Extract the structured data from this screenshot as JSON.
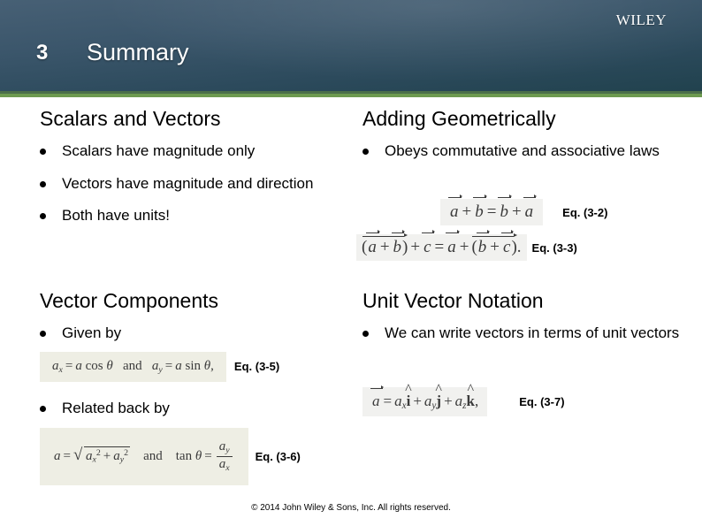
{
  "header": {
    "slide_number": "3",
    "title": "Summary",
    "logo_text": "Wiley",
    "bg_top_color": "#476075",
    "bg_bottom_color": "#21424e",
    "rule_dark_color": "#4b6f4a",
    "rule_green_color": "#6d9a50"
  },
  "sections": {
    "scalars": {
      "title": "Scalars and Vectors",
      "bullets": [
        "Scalars have magnitude only",
        "Vectors have magnitude and direction",
        "Both have units!"
      ]
    },
    "adding": {
      "title": "Adding Geometrically",
      "bullets": [
        "Obeys commutative and associative laws"
      ]
    },
    "components": {
      "title": "Vector Components",
      "bullets": [
        "Given by",
        "Related back by"
      ]
    },
    "unitvector": {
      "title": "Unit Vector Notation",
      "bullets": [
        "We can write vectors in terms of unit vectors"
      ]
    }
  },
  "equations": {
    "eq32": {
      "label": "Eq. (3-2)",
      "latex": "a⃗ + b⃗ = b⃗ + a⃗",
      "parts": {
        "a1": "a",
        "b1": "b",
        "b2": "b",
        "a2": "a",
        "plus": "+",
        "equals": "="
      }
    },
    "eq33": {
      "label": "Eq. (3-3)",
      "latex": "(a⃗ + b⃗) + c⃗ = a⃗ + (b⃗ + c⃗).",
      "parts": {
        "a1": "a",
        "b1": "b",
        "c1": "c",
        "a2": "a",
        "b2": "b",
        "c2": "c",
        "open": "(",
        "close": ")",
        "period": "."
      }
    },
    "eq35": {
      "label": "Eq. (3-5)",
      "latex": "a_x = a cos θ  and  a_y = a sin θ,",
      "parts": {
        "a": "a",
        "x": "x",
        "y": "y",
        "cos": "cos",
        "sin": "sin",
        "theta": "θ",
        "and": "and",
        "comma": ","
      }
    },
    "eq36": {
      "label": "Eq. (3-6)",
      "latex": "a = √(a_x² + a_y²)  and  tan θ = a_y / a_x",
      "parts": {
        "a": "a",
        "x": "x",
        "y": "y",
        "two": "2",
        "tan": "tan",
        "theta": "θ",
        "and": "and",
        "radical": "√"
      }
    },
    "eq37": {
      "label": "Eq. (3-7)",
      "latex": "a⃗ = a_x î + a_y ĵ + a_z k̂,",
      "parts": {
        "a": "a",
        "x": "x",
        "y": "y",
        "z": "z",
        "i": "i",
        "j": "j",
        "k": "k",
        "comma": ","
      }
    }
  },
  "footer": {
    "copyright": "© 2014 John Wiley & Sons, Inc. All rights reserved."
  }
}
